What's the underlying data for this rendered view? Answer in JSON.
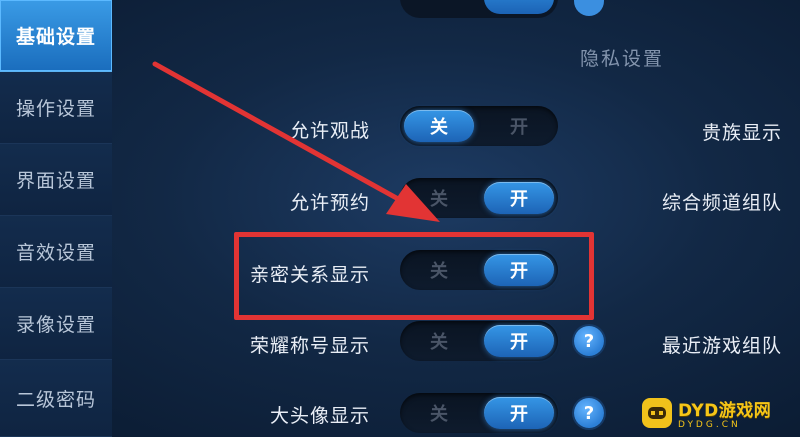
{
  "sidebar": {
    "items": [
      {
        "label": "基础设置",
        "active": true
      },
      {
        "label": "操作设置",
        "active": false
      },
      {
        "label": "界面设置",
        "active": false
      },
      {
        "label": "音效设置",
        "active": false
      },
      {
        "label": "录像设置",
        "active": false
      },
      {
        "label": "二级密码",
        "active": false
      }
    ]
  },
  "section_title": "隐私设置",
  "toggle_labels": {
    "off": "关",
    "on": "开"
  },
  "settings": [
    {
      "label": "允许观战",
      "state": "off",
      "help": false
    },
    {
      "label": "允许预约",
      "state": "on",
      "help": false
    },
    {
      "label": "亲密关系显示",
      "state": "on",
      "help": false,
      "highlighted": true
    },
    {
      "label": "荣耀称号显示",
      "state": "on",
      "help": true
    },
    {
      "label": "大头像显示",
      "state": "on",
      "help": true
    }
  ],
  "right_labels": [
    "贵族显示",
    "综合频道组队",
    "最近游戏组队"
  ],
  "help_symbol": "?",
  "watermark": {
    "main": "DYD游戏网",
    "sub": "DYDG.CN"
  },
  "colors": {
    "accent": "#2f8fe0",
    "highlight": "#e23434",
    "watermark": "#f5c518"
  }
}
